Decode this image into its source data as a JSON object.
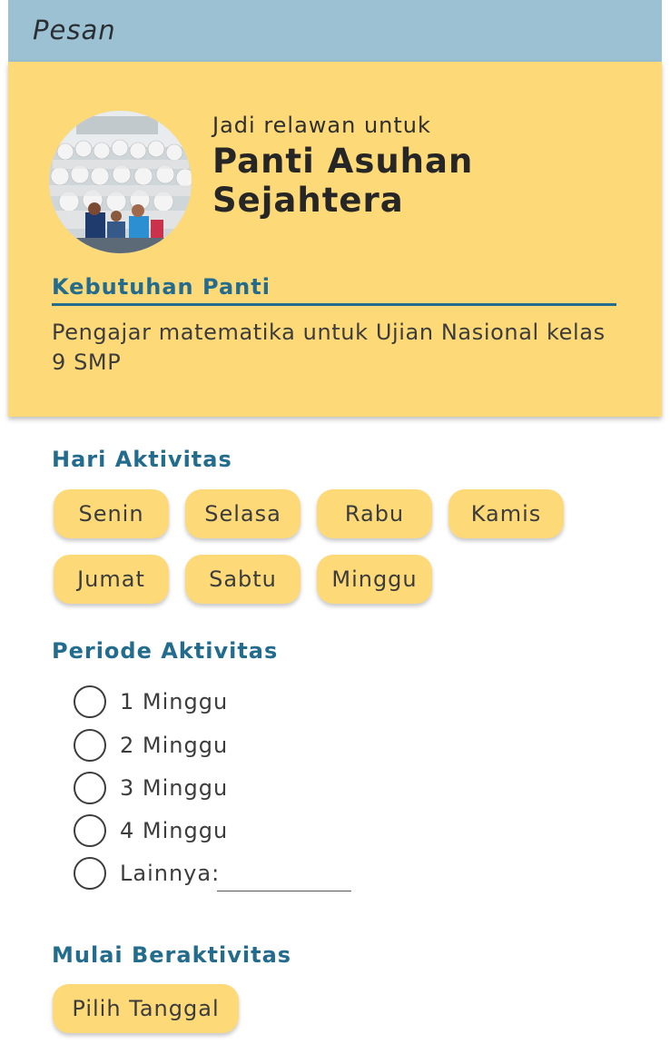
{
  "header": {
    "title": "Pesan"
  },
  "orphanage": {
    "subtitle": "Jadi relawan untuk",
    "name": "Panti Asuhan Sejahtera",
    "needs_heading": "Kebutuhan Panti",
    "needs_text": "Pengajar matematika untuk Ujian Nasional kelas 9 SMP"
  },
  "days": {
    "heading": "Hari Aktivitas",
    "items": [
      "Senin",
      "Selasa",
      "Rabu",
      "Kamis",
      "Jumat",
      "Sabtu",
      "Minggu"
    ]
  },
  "period": {
    "heading": "Periode Aktivitas",
    "options": [
      "1 Minggu",
      "2 Minggu",
      "3 Minggu",
      "4 Minggu",
      "Lainnya:"
    ],
    "other_value": ""
  },
  "start": {
    "heading": "Mulai Beraktivitas",
    "button_label": "Pilih Tanggal"
  },
  "colors": {
    "header_bg": "#9bc1d3",
    "card_bg": "#fdd977",
    "accent": "#236c8e"
  }
}
